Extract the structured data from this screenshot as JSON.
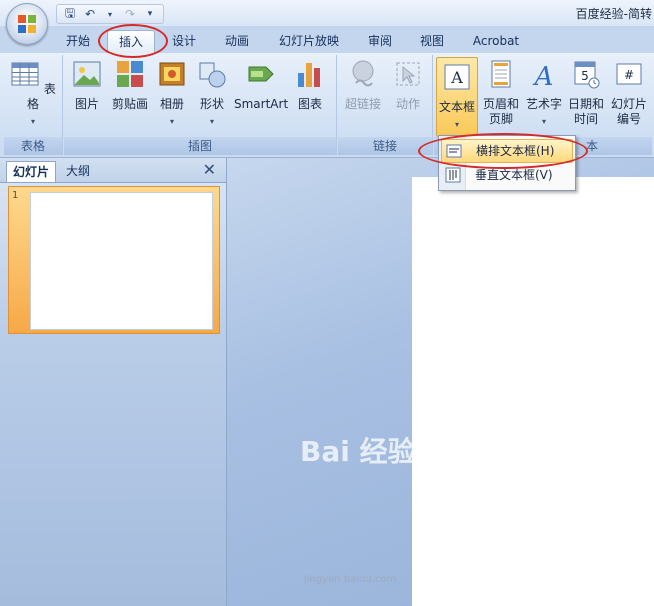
{
  "window": {
    "title": "百度经验-简转"
  },
  "quick_access": {
    "icons": [
      "save-icon",
      "undo-icon",
      "redo-icon",
      "customize-icon"
    ]
  },
  "tabs": [
    {
      "label": "开始",
      "active": false
    },
    {
      "label": "插入",
      "active": true
    },
    {
      "label": "设计",
      "active": false
    },
    {
      "label": "动画",
      "active": false
    },
    {
      "label": "幻灯片放映",
      "active": false
    },
    {
      "label": "审阅",
      "active": false
    },
    {
      "label": "视图",
      "active": false
    },
    {
      "label": "Acrobat",
      "active": false
    }
  ],
  "ribbon": {
    "groups": {
      "tables": {
        "label": "表格",
        "buttons": [
          {
            "label": "表格",
            "icon": "table-icon"
          }
        ]
      },
      "illustrations": {
        "label": "插图",
        "buttons": [
          {
            "label": "图片",
            "icon": "picture-icon"
          },
          {
            "label": "剪贴画",
            "icon": "clipart-icon"
          },
          {
            "label": "相册",
            "icon": "photo-album-icon"
          },
          {
            "label": "形状",
            "icon": "shapes-icon"
          },
          {
            "label": "SmartArt",
            "icon": "smartart-icon"
          },
          {
            "label": "图表",
            "icon": "chart-icon"
          }
        ]
      },
      "links": {
        "label": "链接",
        "buttons": [
          {
            "label": "超链接",
            "icon": "hyperlink-icon",
            "disabled": true
          },
          {
            "label": "动作",
            "icon": "action-icon",
            "disabled": true
          }
        ]
      },
      "text": {
        "label": "文本",
        "label_visible": "本",
        "buttons": [
          {
            "label": "文本框",
            "icon": "textbox-icon",
            "pressed": true
          },
          {
            "label1": "页眉和",
            "label2": "页脚",
            "icon": "header-footer-icon"
          },
          {
            "label": "艺术字",
            "icon": "wordart-icon"
          },
          {
            "label1": "日期和",
            "label2": "时间",
            "icon": "date-time-icon"
          },
          {
            "label1": "幻灯片",
            "label2": "编号",
            "icon": "slide-number-icon"
          }
        ]
      }
    }
  },
  "textbox_menu": {
    "items": [
      {
        "label": "横排文本框(H)",
        "icon": "horizontal-textbox-icon",
        "highlighted": true
      },
      {
        "label": "垂直文本框(V)",
        "icon": "vertical-textbox-icon",
        "highlighted": false
      }
    ]
  },
  "left_pane": {
    "tabs": [
      {
        "label": "幻灯片",
        "active": true
      },
      {
        "label": "大纲",
        "active": false
      }
    ],
    "slides": [
      {
        "number": "1"
      }
    ]
  },
  "watermark": {
    "main": "Bai 经验",
    "sub": "jingyan.baidu.com"
  },
  "colors": {
    "accent": "#d62a2a",
    "ribbon": "#dbe6f5",
    "pane": "#a5bcdd",
    "highlight": "#ffd87a"
  }
}
